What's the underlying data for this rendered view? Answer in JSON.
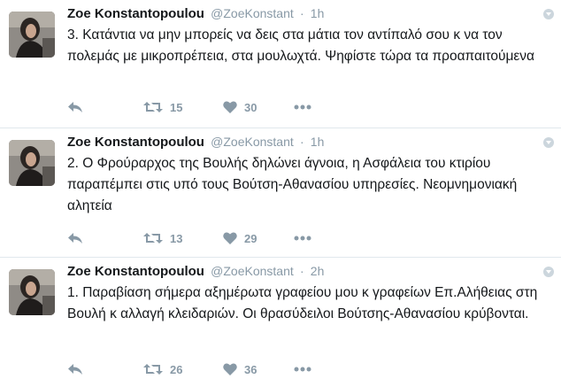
{
  "tweets": [
    {
      "fullname": "Zoe Konstantopoulou",
      "username": "@ZoeKonstant",
      "separator": "·",
      "time": "1h",
      "text": "3. Κατάντια να μην μπορείς να δεις στα μάτια τον αντίπαλό σου κ να τον πολεμάς με μικροπρέπεια, στα μουλωχτά. Ψηφίστε τώρα τα προαπαιτούμενα",
      "retweets": "15",
      "likes": "30"
    },
    {
      "fullname": "Zoe Konstantopoulou",
      "username": "@ZoeKonstant",
      "separator": "·",
      "time": "1h",
      "text": "2. Ο Φρούραρχος της Βουλής δηλώνει άγνοια, η Ασφάλεια του κτιρίου παραπέμπει στις υπό τους Βούτση-Αθανασίου υπηρεσίες. Νεομνημονιακή αλητεία",
      "retweets": "13",
      "likes": "29"
    },
    {
      "fullname": "Zoe Konstantopoulou",
      "username": "@ZoeKonstant",
      "separator": "·",
      "time": "2h",
      "text": "1. Παραβίαση σήμερα αξημέρωτα γραφείου μου κ γραφείων Επ.Αλήθειας στη Βουλή κ αλλαγή κλειδαριών. Οι θρασύδειλοι Βούτσης-Αθανασίου κρύβονται.",
      "retweets": "26",
      "likes": "36"
    }
  ],
  "icons": {
    "reply": "reply-icon",
    "retweet": "retweet-icon",
    "like": "heart-icon",
    "more": "more-options-icon",
    "caret": "chevron-down-icon"
  },
  "colors": {
    "icon": "#8899a6",
    "divider": "#e1e8ed",
    "text": "#14171a",
    "meta": "#8899a6"
  }
}
